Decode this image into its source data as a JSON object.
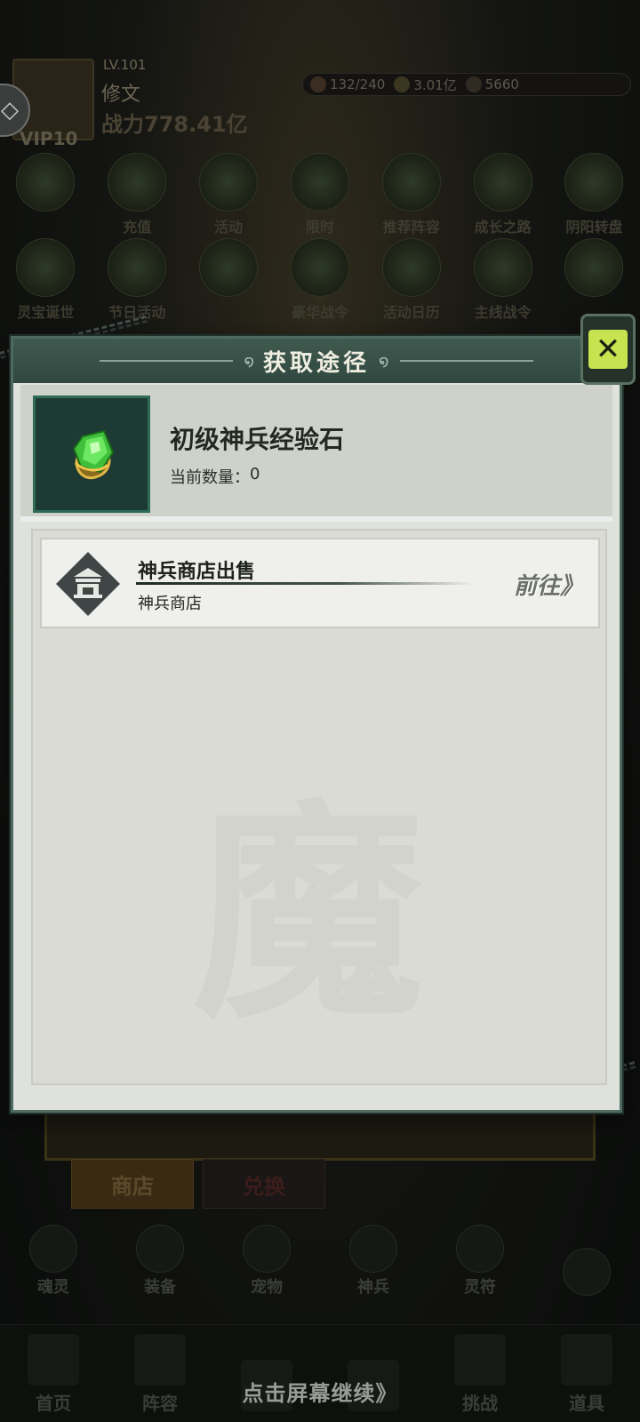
{
  "player": {
    "level": "LV.101",
    "name": "修文",
    "power": "战力778.41亿",
    "vip": "VIP10"
  },
  "resources": [
    {
      "icon": "stamina-icon",
      "value": "132/240"
    },
    {
      "icon": "coin-icon",
      "value": "3.01亿"
    },
    {
      "icon": "gem-icon",
      "value": "5660"
    }
  ],
  "menu_row1": [
    {
      "label": "",
      "icon": "event-icon"
    },
    {
      "label": "充值",
      "icon": "recharge-icon"
    },
    {
      "label": "活动",
      "icon": "activity-icon"
    },
    {
      "label": "限时",
      "icon": "limited-icon"
    },
    {
      "label": "推荐阵容",
      "icon": "lineup-icon"
    },
    {
      "label": "成长之路",
      "icon": "growth-icon"
    },
    {
      "label": "阴阳转盘",
      "icon": "wheel-icon"
    }
  ],
  "menu_row2": [
    {
      "label": "灵宝诞世",
      "icon": "treasure-icon"
    },
    {
      "label": "节日活动",
      "icon": "festival-icon"
    },
    {
      "label": "",
      "icon": "gift-icon"
    },
    {
      "label": "豪华战令",
      "icon": "battlepass-icon"
    },
    {
      "label": "活动日历",
      "icon": "calendar-icon"
    },
    {
      "label": "主线战令",
      "icon": "mainpass-icon"
    },
    {
      "label": "",
      "icon": "pass-icon"
    }
  ],
  "shop_tabs": {
    "shop": "商店",
    "exchange": "兑换"
  },
  "sub_nav": [
    {
      "label": "魂灵",
      "icon": "soul-icon"
    },
    {
      "label": "装备",
      "icon": "equipment-icon"
    },
    {
      "label": "宠物",
      "icon": "pet-icon"
    },
    {
      "label": "神兵",
      "icon": "weapon-icon"
    },
    {
      "label": "灵符",
      "icon": "talisman-icon"
    },
    {
      "label": "",
      "icon": "plus-icon"
    }
  ],
  "bottom_nav": [
    {
      "label": "首页",
      "icon": "home-icon"
    },
    {
      "label": "阵容",
      "icon": "formation-icon"
    },
    {
      "label": "",
      "icon": "summon-icon"
    },
    {
      "label": "",
      "icon": "battle-icon"
    },
    {
      "label": "挑战",
      "icon": "challenge-icon"
    },
    {
      "label": "道具",
      "icon": "items-icon"
    }
  ],
  "continue_hint": "点击屏幕继续》",
  "dialog": {
    "title": "获取途径",
    "item": {
      "name": "初级神兵经验石",
      "count_label": "当前数量：",
      "count_value": "0",
      "icon": "green-gem-icon"
    },
    "sources": [
      {
        "title": "神兵商店出售",
        "subtitle": "神兵商店",
        "icon": "shop-building-icon",
        "action": "前往》"
      }
    ],
    "watermark": "魔"
  },
  "colors": {
    "header_green": "#405a50",
    "panel_bg": "#dfe2dc",
    "close_accent": "#c7e34f",
    "item_frame": "#2f6c56"
  }
}
